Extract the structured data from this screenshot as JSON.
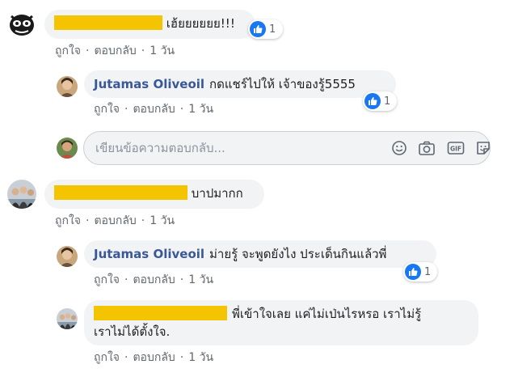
{
  "actions": {
    "like": "ถูกใจ",
    "reply": "ตอบกลับ",
    "separator": "·"
  },
  "comments": [
    {
      "text": "เฮ้ยยยยยย!!!",
      "time": "1 วัน",
      "reactions": "1",
      "replies": [
        {
          "author": "Jutamas Oliveoil",
          "text": "กดแชร์ไปให้ เจ้าของรู้5555",
          "time": "1 วัน",
          "reactions": "1"
        }
      ]
    },
    {
      "text": "บาปมากก",
      "time": "1 วัน",
      "replies": [
        {
          "author": "Jutamas Oliveoil",
          "text": "ม่ายรู้ จะพูดยังไง ประเด็นกินแล้วพี่",
          "time": "1 วัน",
          "reactions": "1"
        },
        {
          "text_line1": "พี่เข้าใจเลย แค่ไม่เป่นไรหรอ เราไม่รู้",
          "text_line2": "เราไม่ได้ตั้งใจ.",
          "time": "1 วัน"
        }
      ]
    }
  ],
  "reply_box": {
    "placeholder": "เขียนข้อความตอบกลับ..."
  },
  "icons": {
    "emoji": "smiley-icon",
    "camera": "camera-icon",
    "gif": "gif-icon",
    "sticker": "sticker-icon",
    "like": "thumbs-up-icon"
  },
  "colors": {
    "link": "#385898",
    "redaction": "#f5c400",
    "like_blue": "#1877f2",
    "bubble": "#f2f3f5"
  }
}
